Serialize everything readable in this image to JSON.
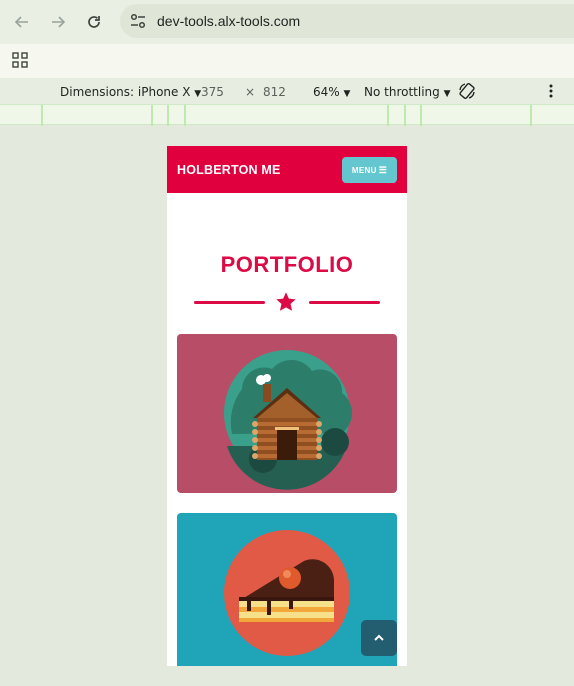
{
  "browser": {
    "back_icon": "arrow-left-icon",
    "forward_icon": "arrow-right-icon",
    "reload_icon": "reload-icon",
    "url": "dev-tools.alx-tools.com"
  },
  "devtools": {
    "dimensions_label": "Dimensions: iPhone X",
    "width": "375",
    "times": "×",
    "height": "812",
    "zoom": "64%",
    "throttling": "No throttling"
  },
  "site": {
    "brand": "HOLBERTON ME",
    "menu_label": "MENU",
    "section_title": "PORTFOLIO",
    "colors": {
      "primary": "#e1003d",
      "accent": "#64c7cf",
      "card_cabin": "#b74d66",
      "card_cake": "#20a4b8",
      "scroll_button": "#225e70"
    },
    "cards": [
      {
        "icon": "cabin-icon"
      },
      {
        "icon": "cake-icon"
      }
    ]
  }
}
